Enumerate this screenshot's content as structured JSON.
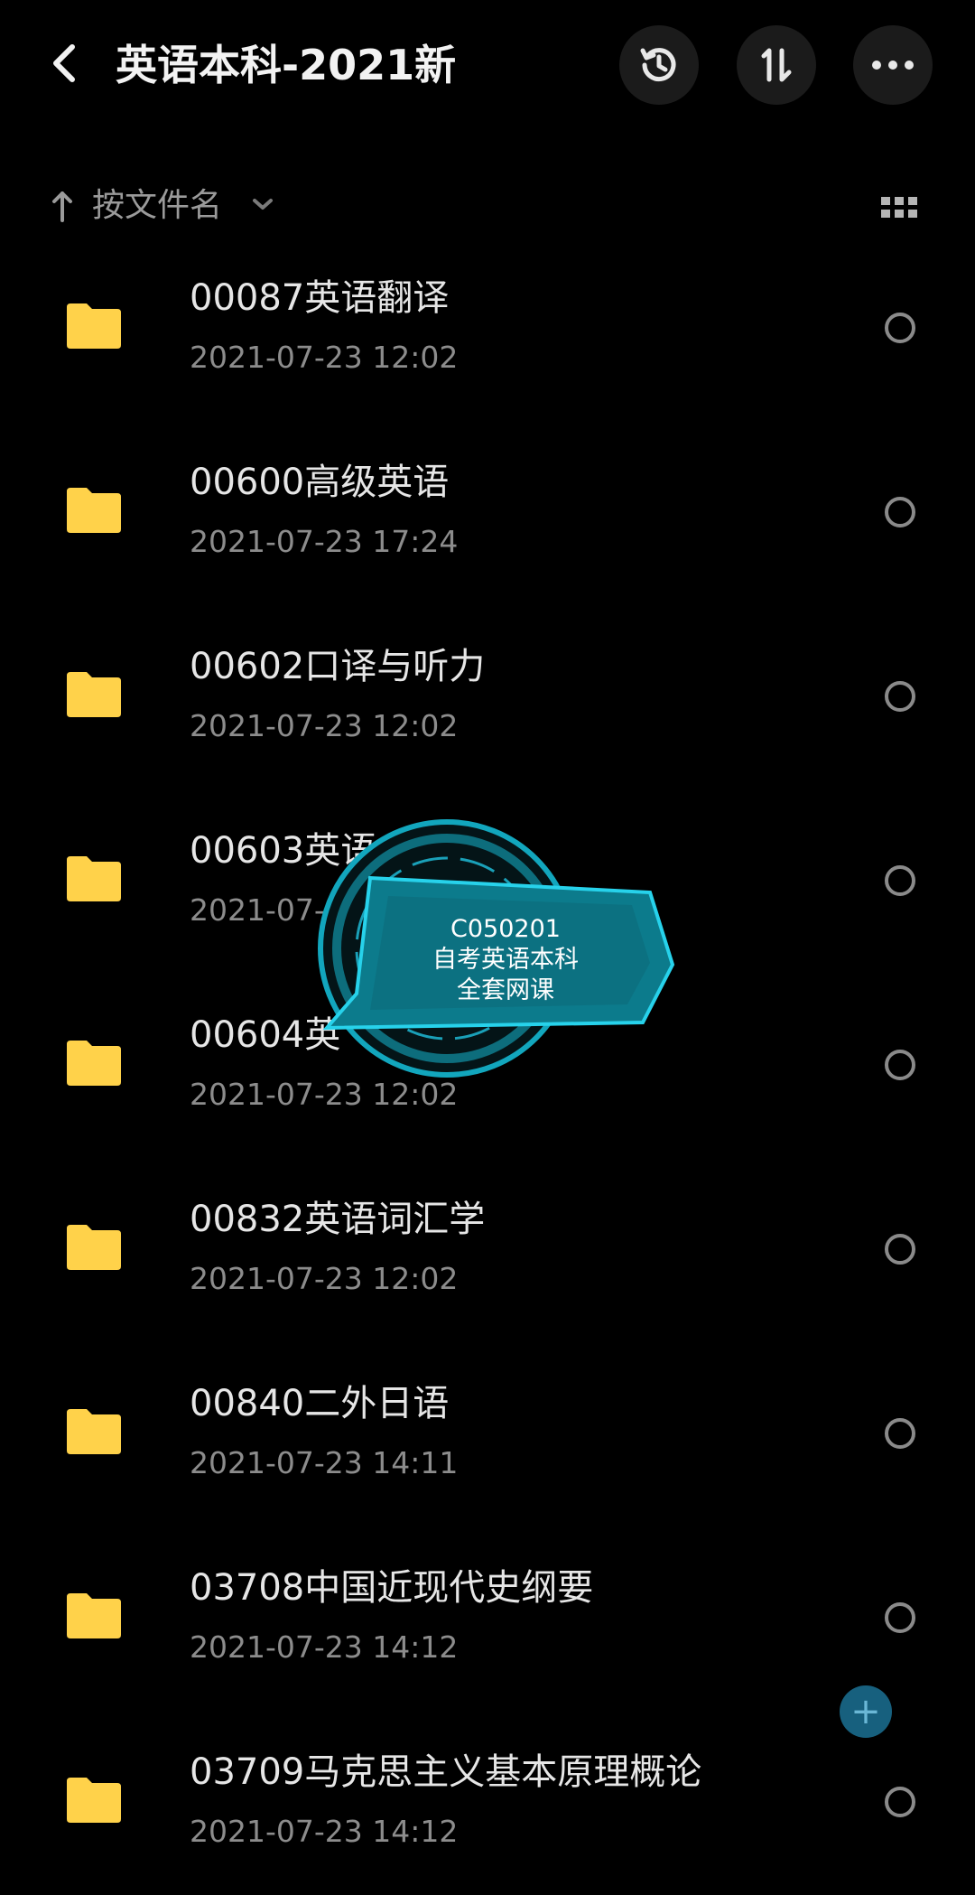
{
  "header": {
    "title": "英语本科-2021新"
  },
  "sort": {
    "label": "按文件名"
  },
  "files": [
    {
      "name": "00087英语翻译",
      "date": "2021-07-23  12:02"
    },
    {
      "name": "00600高级英语",
      "date": "2021-07-23  17:24"
    },
    {
      "name": "00602口译与听力",
      "date": "2021-07-23  12:02"
    },
    {
      "name": "00603英语",
      "date": "2021-07-"
    },
    {
      "name": "00604英",
      "date": "2021-07-23  12:02"
    },
    {
      "name": "00832英语词汇学",
      "date": "2021-07-23  12:02"
    },
    {
      "name": "00840二外日语",
      "date": "2021-07-23  14:11"
    },
    {
      "name": "03708中国近现代史纲要",
      "date": "2021-07-23  14:12"
    },
    {
      "name": "03709马克思主义基本原理概论",
      "date": "2021-07-23  14:12"
    }
  ],
  "watermark": {
    "line1": "C050201",
    "line2": "自考英语本科",
    "line3": "全套网课"
  },
  "fab": {
    "label": "+"
  },
  "colors": {
    "background": "#000000",
    "folder": "#FFD24A",
    "watermark": "#1aa0b8"
  },
  "icons": [
    "back-arrow-icon",
    "history-icon",
    "sort-order-icon",
    "more-icon",
    "sort-direction-icon",
    "chevron-down-icon",
    "grid-view-icon",
    "folder-icon",
    "radio-icon",
    "plus-icon"
  ]
}
